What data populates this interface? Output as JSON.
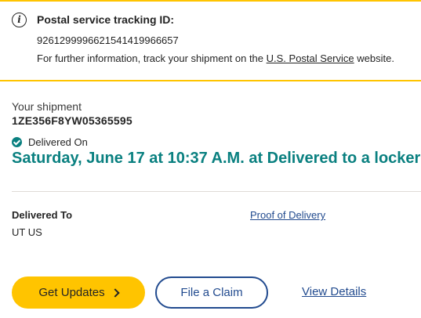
{
  "notice": {
    "icon": "info-icon",
    "title": "Postal service tracking ID:",
    "tracking_id": "9261299996621541419966657",
    "text_before": "For further information, track your shipment on the ",
    "link_text": "U.S. Postal Service",
    "text_after": " website."
  },
  "shipment": {
    "label": "Your shipment",
    "number": "1ZE356F8YW05365595",
    "status_icon": "check-circle-icon",
    "status_label": "Delivered On",
    "status_detail": "Saturday, June 17 at 10:37 A.M. at Delivered to a locker"
  },
  "delivery": {
    "label": "Delivered To",
    "value": "UT US",
    "proof_link": "Proof of Delivery"
  },
  "actions": {
    "get_updates": "Get Updates",
    "file_claim": "File a Claim",
    "view_details": "View Details"
  },
  "colors": {
    "accent_yellow": "#FFC400",
    "status_teal": "#0A8080",
    "link_blue": "#224B8F"
  }
}
